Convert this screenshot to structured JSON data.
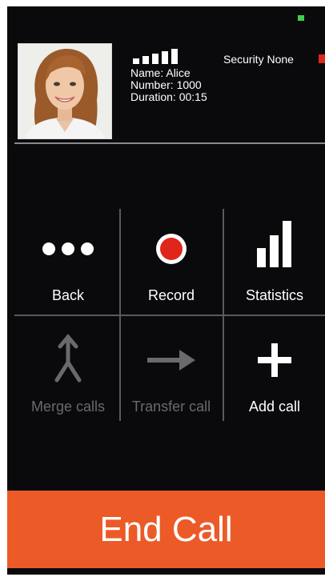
{
  "status": {
    "indicator_color": "#3fd04a"
  },
  "security": {
    "label": "Security None",
    "indicator_color": "#e0261b"
  },
  "caller": {
    "avatar_icon": "caller-photo",
    "signal_bars_filled": 5,
    "name_line": "Name: Alice",
    "number_line": "Number: 1000",
    "duration_line": "Duration: 00:15"
  },
  "actions": [
    {
      "label": "Back",
      "icon": "dots-icon",
      "enabled": true
    },
    {
      "label": "Record",
      "icon": "record-icon",
      "enabled": true
    },
    {
      "label": "Statistics",
      "icon": "bars-icon",
      "enabled": true
    },
    {
      "label": "Merge calls",
      "icon": "merge-icon",
      "enabled": false
    },
    {
      "label": "Transfer call",
      "icon": "arrow-right-icon",
      "enabled": false
    },
    {
      "label": "Add call",
      "icon": "plus-icon",
      "enabled": true
    }
  ],
  "end_call": {
    "label": "End Call",
    "color": "#ec5a28"
  }
}
